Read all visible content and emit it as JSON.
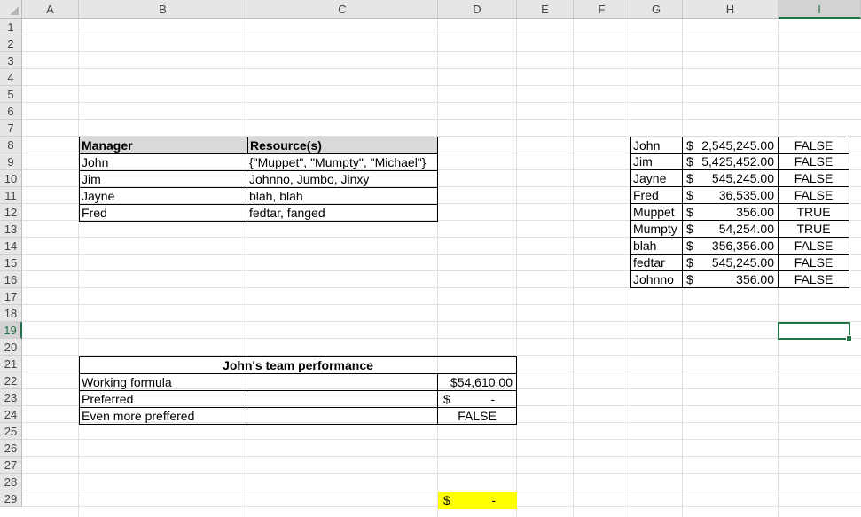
{
  "columns": [
    "A",
    "B",
    "C",
    "D",
    "E",
    "F",
    "G",
    "H",
    "I"
  ],
  "rows": [
    "1",
    "2",
    "3",
    "4",
    "5",
    "6",
    "7",
    "8",
    "9",
    "10",
    "11",
    "12",
    "13",
    "14",
    "15",
    "16",
    "17",
    "18",
    "19",
    "20",
    "21",
    "22",
    "23",
    "24",
    "25",
    "26",
    "27",
    "28",
    "29"
  ],
  "active_cell": {
    "column": "I",
    "row": "19"
  },
  "manager_table": {
    "header_manager": "Manager",
    "header_resources": "Resource(s)",
    "rows": [
      {
        "manager": "John",
        "resources": "{\"Muppet\", \"Mumpty\", \"Michael\"}"
      },
      {
        "manager": "Jim",
        "resources": "Johnno, Jumbo, Jinxy"
      },
      {
        "manager": "Jayne",
        "resources": "blah, blah"
      },
      {
        "manager": "Fred",
        "resources": "fedtar, fanged"
      }
    ]
  },
  "lookup_table": {
    "rows": [
      {
        "name": "John",
        "currency": "$",
        "amount": "2,545,245.00",
        "flag": "FALSE"
      },
      {
        "name": "Jim",
        "currency": "$",
        "amount": "5,425,452.00",
        "flag": "FALSE"
      },
      {
        "name": "Jayne",
        "currency": "$",
        "amount": "545,245.00",
        "flag": "FALSE"
      },
      {
        "name": "Fred",
        "currency": "$",
        "amount": "36,535.00",
        "flag": "FALSE"
      },
      {
        "name": "Muppet",
        "currency": "$",
        "amount": "356.00",
        "flag": "TRUE"
      },
      {
        "name": "Mumpty",
        "currency": "$",
        "amount": "54,254.00",
        "flag": "TRUE"
      },
      {
        "name": "blah",
        "currency": "$",
        "amount": "356,356.00",
        "flag": "FALSE"
      },
      {
        "name": "fedtar",
        "currency": "$",
        "amount": "545,245.00",
        "flag": "FALSE"
      },
      {
        "name": "Johnno",
        "currency": "$",
        "amount": "356.00",
        "flag": "FALSE"
      }
    ]
  },
  "performance_table": {
    "title": "John's team performance",
    "rows": [
      {
        "label": "Working formula",
        "currency": "$",
        "value": "54,610.00"
      },
      {
        "label": "Preferred",
        "currency": "$",
        "value": "-"
      },
      {
        "label": "Even more preffered",
        "currency": "",
        "value": "FALSE"
      }
    ]
  },
  "highlight_cell": {
    "currency": "$",
    "value": "-",
    "color": "#ffff00"
  },
  "colors": {
    "header_fill": "#d9d9d9",
    "selection": "#217346",
    "gridline": "#e1e1e1"
  }
}
